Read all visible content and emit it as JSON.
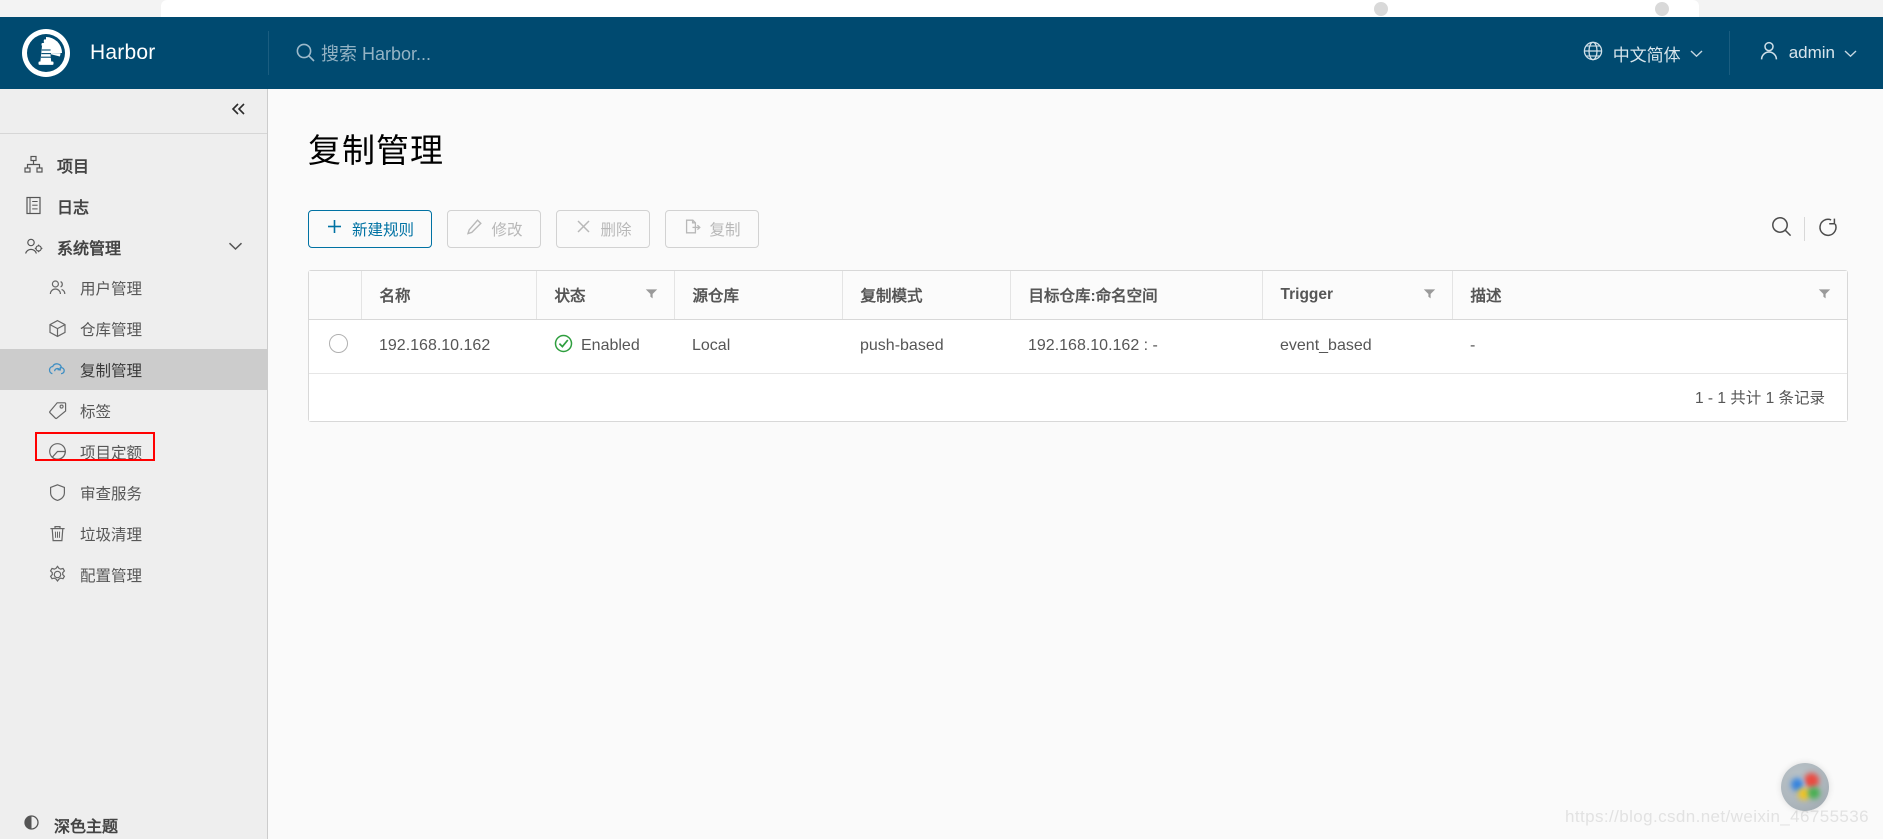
{
  "brand": {
    "name": "Harbor",
    "logo_icon": "harbor-lighthouse-logo"
  },
  "search": {
    "placeholder": "搜索 Harbor...",
    "icon": "search-icon"
  },
  "header": {
    "language": "中文简体",
    "language_icon": "globe-icon",
    "language_caret": "chevron-down-icon",
    "user": "admin",
    "user_icon": "user-icon",
    "user_caret": "chevron-down-icon",
    "accent_color": "#004a70"
  },
  "sidebar": {
    "collapse_icon": "double-chevron-left-icon",
    "items": [
      {
        "label": "项目",
        "icon": "projects-icon",
        "level": "top"
      },
      {
        "label": "日志",
        "icon": "logs-icon",
        "level": "top"
      },
      {
        "label": "系统管理",
        "icon": "administration-icon",
        "level": "top",
        "caret": "chevron-down-icon"
      },
      {
        "label": "用户管理",
        "icon": "users-icon",
        "level": "sub"
      },
      {
        "label": "仓库管理",
        "icon": "registry-icon",
        "level": "sub"
      },
      {
        "label": "复制管理",
        "icon": "replication-cloud-icon",
        "level": "sub",
        "active": true,
        "highlight_color": "#ff0000"
      },
      {
        "label": "标签",
        "icon": "tag-icon",
        "level": "sub"
      },
      {
        "label": "项目定额",
        "icon": "pie-chart-icon",
        "level": "sub"
      },
      {
        "label": "审查服务",
        "icon": "shield-icon",
        "level": "sub"
      },
      {
        "label": "垃圾清理",
        "icon": "trash-icon",
        "level": "sub"
      },
      {
        "label": "配置管理",
        "icon": "gear-icon",
        "level": "sub"
      }
    ],
    "bottom_item": {
      "label": "深色主题",
      "icon": "theme-icon"
    }
  },
  "main": {
    "title": "复制管理",
    "toolbar": {
      "new_rule": {
        "label": "新建规则",
        "icon": "plus-icon",
        "state": "enabled"
      },
      "edit": {
        "label": "修改",
        "icon": "pencil-icon",
        "state": "disabled"
      },
      "delete": {
        "label": "删除",
        "icon": "close-x-icon",
        "state": "disabled"
      },
      "replicate": {
        "label": "复制",
        "icon": "copy-export-icon",
        "state": "disabled"
      },
      "search_icon": "search-icon",
      "refresh_icon": "refresh-icon"
    },
    "table": {
      "columns": [
        {
          "label": "",
          "key": "select",
          "filter": false
        },
        {
          "label": "名称",
          "key": "name",
          "filter": false
        },
        {
          "label": "状态",
          "key": "status",
          "filter": true
        },
        {
          "label": "源仓库",
          "key": "source",
          "filter": false
        },
        {
          "label": "复制模式",
          "key": "mode",
          "filter": false
        },
        {
          "label": "目标仓库:命名空间",
          "key": "target",
          "filter": false
        },
        {
          "label": "Trigger",
          "key": "trigger",
          "filter": true
        },
        {
          "label": "描述",
          "key": "desc",
          "filter": true
        }
      ],
      "rows": [
        {
          "select": "radio-unselected",
          "name": "192.168.10.162",
          "status": "Enabled",
          "status_icon": "check-circle-icon",
          "status_color": "#2e9e3e",
          "source": "Local",
          "mode": "push-based",
          "target": "192.168.10.162 : -",
          "trigger": "event_based",
          "desc": "-"
        }
      ],
      "footer": "1 - 1 共计 1 条记录"
    }
  },
  "overlay": {
    "watermark": "https://blog.csdn.net/weixin_46755536",
    "orb_icon": "assistant-orb-icon"
  }
}
